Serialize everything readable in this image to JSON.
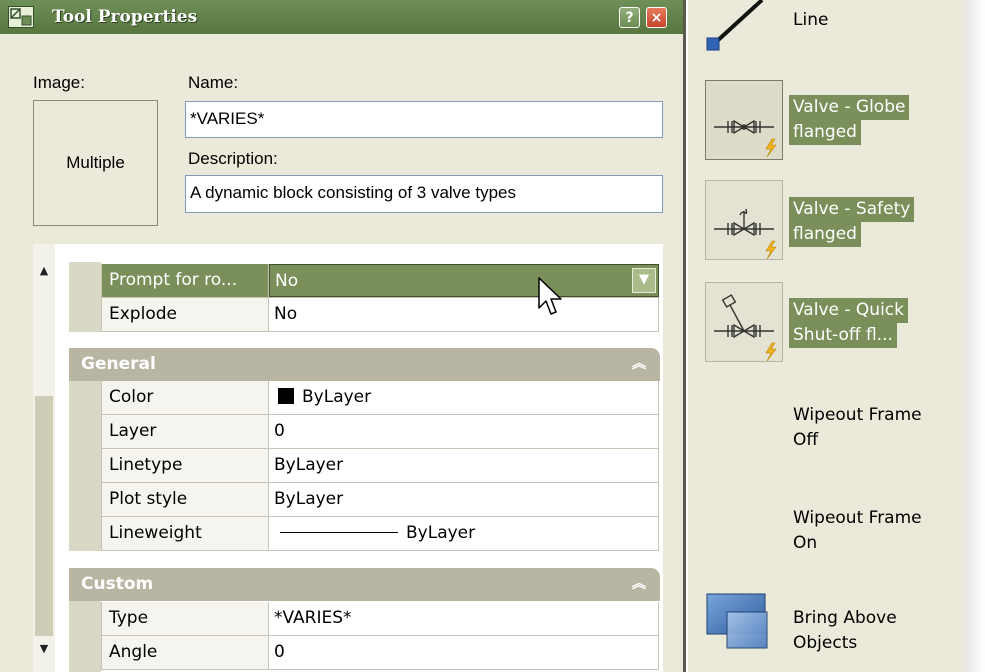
{
  "dialog": {
    "title": "Tool Properties",
    "help_btn": "?",
    "close_btn": "×",
    "image_label": "Image:",
    "image_value": "Multiple",
    "name_label": "Name:",
    "name_value": "*VARIES*",
    "description_label": "Description:",
    "description_value": "A dynamic block consisting of 3 valve types"
  },
  "props": {
    "top_rows": [
      {
        "name": "Prompt for ro...",
        "value": "No"
      },
      {
        "name": "Explode",
        "value": "No"
      }
    ],
    "general": {
      "title": "General",
      "rows": [
        {
          "name": "Color",
          "value": "ByLayer"
        },
        {
          "name": "Layer",
          "value": "0"
        },
        {
          "name": "Linetype",
          "value": "ByLayer"
        },
        {
          "name": "Plot style",
          "value": "ByLayer"
        },
        {
          "name": "Lineweight",
          "value": "ByLayer"
        }
      ]
    },
    "custom": {
      "title": "Custom",
      "rows": [
        {
          "name": "Type",
          "value": "*VARIES*"
        },
        {
          "name": "Angle",
          "value": "0"
        }
      ]
    },
    "collapse_glyph": "⌃"
  },
  "palette": {
    "items": [
      {
        "label": "Line",
        "icon": "line-tool-icon"
      },
      {
        "label_l1": "Valve - Globe",
        "label_l2": "flanged",
        "icon": "globe-valve-icon"
      },
      {
        "label_l1": "Valve - Safety",
        "label_l2": "flanged",
        "icon": "safety-valve-icon"
      },
      {
        "label_l1": "Valve - Quick",
        "label_l2": "Shut-off fl...",
        "icon": "quick-shutoff-valve-icon"
      },
      {
        "label_l1": "Wipeout Frame",
        "label_l2": "Off"
      },
      {
        "label_l1": "Wipeout Frame",
        "label_l2": "On"
      },
      {
        "label_l1": "Bring Above",
        "label_l2": "Objects",
        "icon": "bring-above-icon"
      }
    ]
  },
  "colors": {
    "selection": "#7a8f59",
    "titlebar": "#6f8f58",
    "section_header": "#b8b6a3",
    "dialog_bg": "#ebe9d9"
  }
}
